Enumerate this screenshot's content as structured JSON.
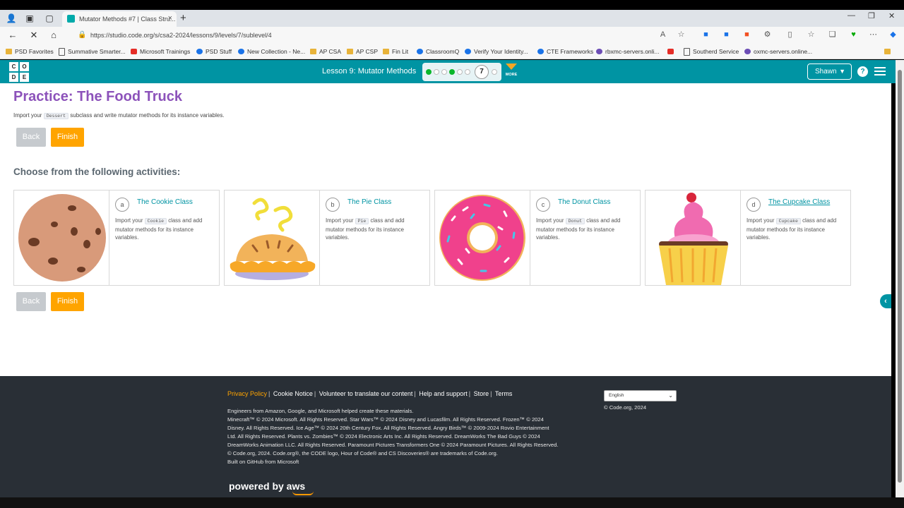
{
  "browser": {
    "tab_title": "Mutator Methods #7 | Class Stru...",
    "url": "https://studio.code.org/s/csa2-2024/lessons/9/levels/7/sublevel/4",
    "bookmarks": [
      "PSD Favorites",
      "Summative Smarter...",
      "Microsoft Trainings",
      "PSD Stuff",
      "New Collection - Ne...",
      "AP CSA",
      "AP CSP",
      "Fin Lit",
      "ClassroomQ",
      "Verify Your Identity...",
      "CTE Frameworks",
      "rbxmc-servers.onli...",
      "Southerd Service",
      "oxmc-servers.online..."
    ]
  },
  "header": {
    "logo_letters": [
      "C",
      "O",
      "D",
      "E"
    ],
    "lesson_title": "Lesson 9: Mutator Methods",
    "current_level": "7",
    "more_label": "MORE",
    "user_name": "Shawn",
    "help_label": "?"
  },
  "main": {
    "title": "Practice: The Food Truck",
    "desc_prefix": "Import your",
    "desc_code": "Dessert",
    "desc_suffix": "subclass and write mutator methods for its instance variables.",
    "back_label": "Back",
    "finish_label": "Finish",
    "choose_heading": "Choose from the following activities:",
    "activities": [
      {
        "letter": "a",
        "title": "The Cookie Class",
        "desc_prefix": "Import your",
        "code": "Cookie",
        "desc_suffix": "class and add mutator methods for its instance variables."
      },
      {
        "letter": "b",
        "title": "The Pie Class",
        "desc_prefix": "Import your",
        "code": "Pie",
        "desc_suffix": "class and add mutator methods for its instance variables."
      },
      {
        "letter": "c",
        "title": "The Donut Class",
        "desc_prefix": "Import your",
        "code": "Donut",
        "desc_suffix": "class and add mutator methods for its instance variables."
      },
      {
        "letter": "d",
        "title": "The Cupcake Class",
        "desc_prefix": "Import your",
        "code": "Cupcake",
        "desc_suffix": "class and add mutator methods for its instance variables."
      }
    ]
  },
  "footer": {
    "links": [
      "Privacy Policy",
      "Cookie Notice",
      "Volunteer to translate our content",
      "Help and support",
      "Store",
      "Terms"
    ],
    "legal": [
      "Engineers from Amazon, Google, and Microsoft helped create these materials.",
      "Minecraft™ © 2024 Microsoft. All Rights Reserved. Star Wars™ © 2024 Disney and Lucasfilm. All Rights Reserved. Frozen™ © 2024 Disney. All Rights Reserved. Ice Age™ © 2024 20th Century Fox. All Rights Reserved. Angry Birds™ © 2009-2024 Rovio Entertainment Ltd. All Rights Reserved. Plants vs. Zombies™ © 2024 Electronic Arts Inc. All Rights Reserved. DreamWorks The Bad Guys © 2024 DreamWorks Animation LLC. All Rights Reserved. Paramount Pictures Transformers One © 2024 Paramount Pictures. All Rights Reserved.",
      "© Code.org, 2024. Code.org®, the CODE logo, Hour of Code® and CS Discoveries® are trademarks of Code.org.",
      "Built on GitHub from Microsoft"
    ],
    "language": "English",
    "copyright": "© Code.org, 2024",
    "aws_text": "powered by aws"
  },
  "colors": {
    "teal": "#0094a3",
    "purple": "#8c52ba",
    "orange": "#ffa400",
    "footer_bg": "#292f36"
  }
}
